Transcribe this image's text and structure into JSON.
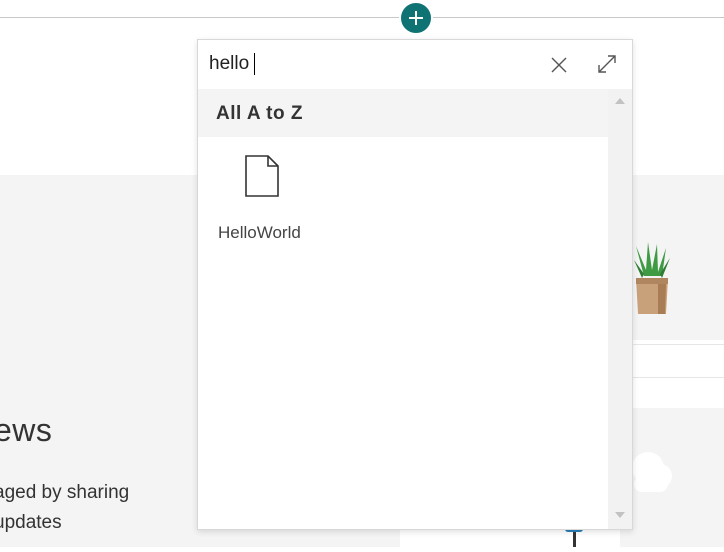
{
  "search": {
    "value": "hello"
  },
  "section": {
    "header": "All A to Z"
  },
  "results": [
    {
      "label": "HelloWorld",
      "icon": "page-icon"
    }
  ],
  "background": {
    "heading_fragment": "ews",
    "description_line1": "aged by sharing",
    "description_line2": "updates"
  },
  "colors": {
    "accent": "#0f7374",
    "header_bg": "#f4f4f4",
    "panel_bg": "#f4f4f4"
  },
  "icons": {
    "add": "plus-icon",
    "clear": "close-icon",
    "expand": "expand-icon",
    "result": "page-icon",
    "scroll_up": "scroll-up-arrow-icon",
    "scroll_down": "scroll-down-arrow-icon"
  }
}
